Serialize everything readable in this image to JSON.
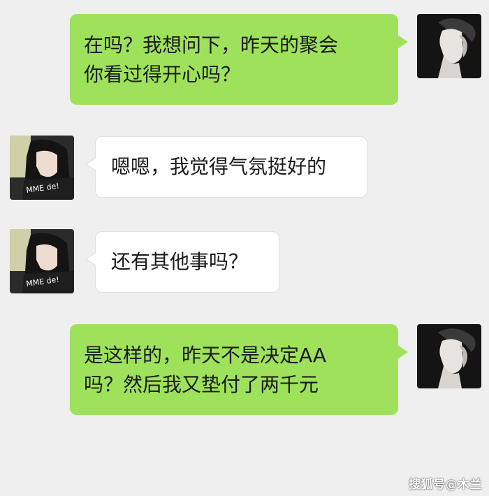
{
  "messages": [
    {
      "side": "right",
      "sender": "male-avatar",
      "lines": [
        "在吗？我想问下，昨天的聚会",
        "你看过得开心吗？"
      ]
    },
    {
      "side": "left",
      "sender": "female-avatar",
      "lines": [
        "嗯嗯，我觉得气氛挺好的"
      ]
    },
    {
      "side": "left",
      "sender": "female-avatar",
      "lines": [
        "还有其他事吗？"
      ]
    },
    {
      "side": "right",
      "sender": "male-avatar",
      "lines": [
        "是这样的，昨天不是决定AA",
        "吗？然后我又垫付了两千元"
      ]
    }
  ],
  "watermark": "搜狐号@木兰",
  "colors": {
    "background": "#efefef",
    "sent_bubble": "#9ee25c",
    "received_bubble": "#ffffff"
  }
}
